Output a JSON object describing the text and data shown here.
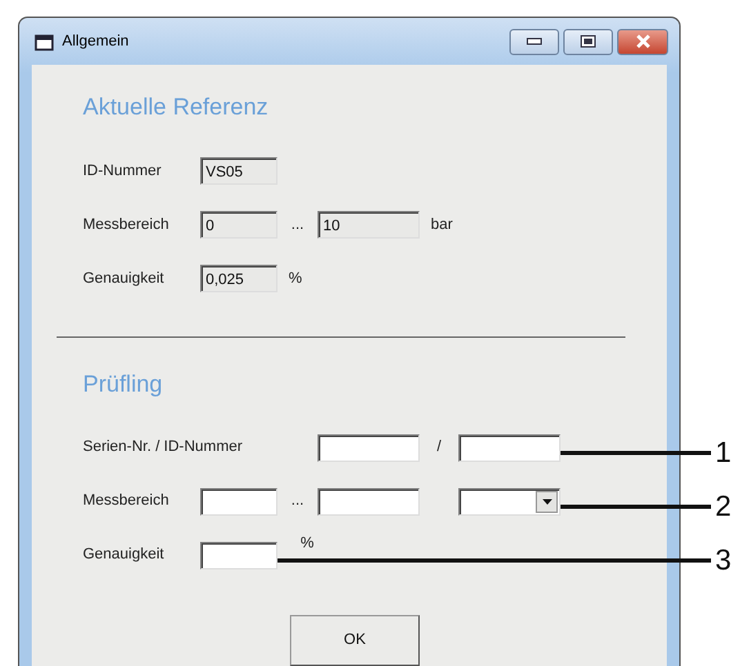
{
  "window": {
    "title": "Allgemein"
  },
  "sections": [
    {
      "title": "Aktuelle Referenz",
      "rows": [
        {
          "items": [
            {
              "kind": "label",
              "text": "ID-Nummer"
            },
            {
              "kind": "field",
              "value": "VS05",
              "disabled": true
            }
          ]
        },
        {
          "items": [
            {
              "kind": "label",
              "text": "Messbereich"
            },
            {
              "kind": "field",
              "value": "0",
              "disabled": true
            },
            {
              "kind": "text",
              "text": "..."
            },
            {
              "kind": "field",
              "value": "10",
              "disabled": true
            },
            {
              "kind": "text",
              "text": "bar"
            }
          ]
        },
        {
          "items": [
            {
              "kind": "label",
              "text": "Genauigkeit"
            },
            {
              "kind": "field",
              "value": "0,025",
              "disabled": true
            },
            {
              "kind": "text",
              "text": "%"
            }
          ]
        }
      ]
    },
    {
      "title": "Prüfling",
      "rows": [
        {
          "items": [
            {
              "kind": "label",
              "text": "Serien-Nr. / ID-Nummer"
            },
            {
              "kind": "field",
              "value": "",
              "disabled": false
            },
            {
              "kind": "text",
              "text": "/"
            },
            {
              "kind": "field",
              "value": "",
              "disabled": false,
              "callout": "1"
            }
          ]
        },
        {
          "items": [
            {
              "kind": "label",
              "text": "Messbereich"
            },
            {
              "kind": "field",
              "value": "",
              "disabled": false
            },
            {
              "kind": "text",
              "text": "..."
            },
            {
              "kind": "field",
              "value": "",
              "disabled": false
            },
            {
              "kind": "dropdown",
              "value": "",
              "disabled": false,
              "callout": "2"
            }
          ]
        },
        {
          "items": [
            {
              "kind": "label",
              "text": "Genauigkeit"
            },
            {
              "kind": "field",
              "value": "",
              "disabled": false,
              "callout": "3"
            },
            {
              "kind": "text",
              "text": "%"
            }
          ]
        }
      ]
    }
  ],
  "buttons": [
    "OK"
  ]
}
